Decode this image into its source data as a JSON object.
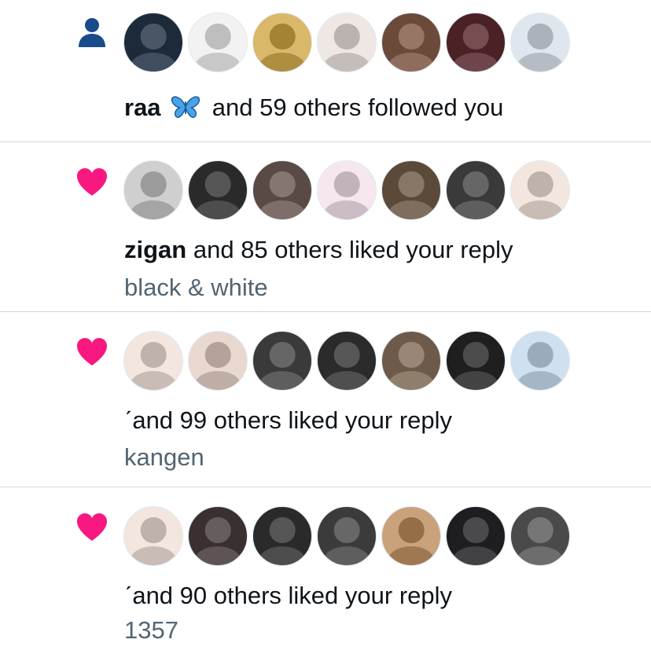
{
  "notifications": [
    {
      "type": "follow",
      "icon": "person-icon",
      "actor": "raa",
      "action": "and 59 others followed you",
      "subtext": "",
      "avatars": [
        "#1d2a3a",
        "#f2f2f2",
        "#d9b86a",
        "#efe7e3",
        "#6b4a3a",
        "#4a2226",
        "#dfe6ee"
      ]
    },
    {
      "type": "like",
      "icon": "heart-icon",
      "actor": "zigan",
      "action": "and 85 others liked your reply",
      "subtext": "black & white",
      "avatars": [
        "#cfcfcf",
        "#2a2a2a",
        "#5a4a45",
        "#f6e6f0",
        "#5b4a3a",
        "#3a3a3a",
        "#f3e6df"
      ]
    },
    {
      "type": "like",
      "icon": "heart-icon",
      "actor": "",
      "action": "and 99 others liked your reply",
      "subtext": "kangen",
      "avatars": [
        "#f3e6df",
        "#e9d8d0",
        "#3a3a3a",
        "#2b2b2b",
        "#6d5a4a",
        "#1f1f1f",
        "#cfe0f0"
      ]
    },
    {
      "type": "like",
      "icon": "heart-icon",
      "actor": "",
      "action": "and 90 others liked your reply",
      "subtext": "1357",
      "avatars": [
        "#f3e6df",
        "#3a3030",
        "#2a2a2a",
        "#3b3b3b",
        "#c9a27c",
        "#1e1e22",
        "#4a4a4a"
      ]
    }
  ],
  "colors": {
    "follow_icon": "#1a4a8a",
    "like_icon": "#f91880",
    "subtext": "#536471",
    "divider": "#cfd9de"
  }
}
